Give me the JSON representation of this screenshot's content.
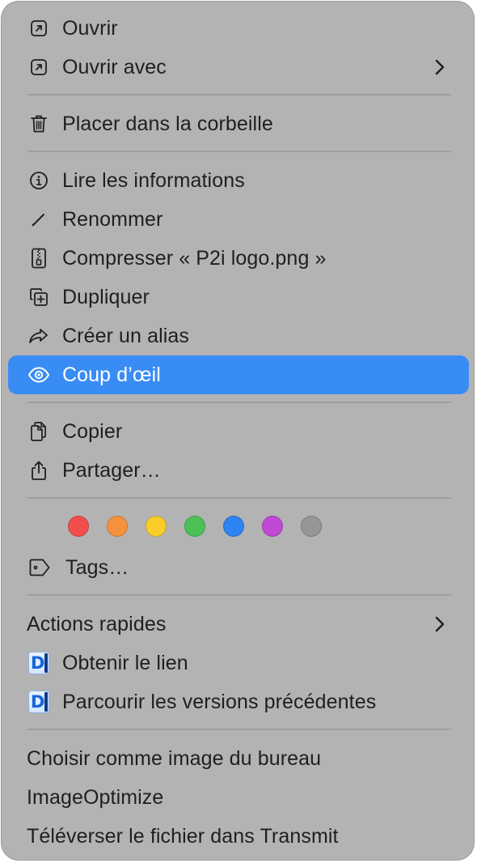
{
  "menu": {
    "open": "Ouvrir",
    "open_with": "Ouvrir avec",
    "trash": "Placer dans la corbeille",
    "get_info": "Lire les informations",
    "rename": "Renommer",
    "compress": "Compresser « P2i logo.png »",
    "duplicate": "Dupliquer",
    "make_alias": "Créer un alias",
    "quick_look": "Coup d’œil",
    "copy": "Copier",
    "share": "Partager…",
    "tags": "Tags…",
    "quick_actions": "Actions rapides",
    "get_link": "Obtenir le lien",
    "browse_versions": "Parcourir les versions précédentes",
    "set_desktop": "Choisir comme image du bureau",
    "image_optimize": "ImageOptimize",
    "upload_transmit": "Téléverser le fichier dans Transmit"
  },
  "tag_colors": [
    {
      "name": "red",
      "color": "#f14e4c"
    },
    {
      "name": "orange",
      "color": "#f5913c"
    },
    {
      "name": "yellow",
      "color": "#f8cd2a"
    },
    {
      "name": "green",
      "color": "#4cc156"
    },
    {
      "name": "blue",
      "color": "#2f84f3"
    },
    {
      "name": "purple",
      "color": "#c04ad6"
    },
    {
      "name": "gray",
      "color": "#969699"
    }
  ],
  "colors": {
    "menu_background": "#b3b3b3",
    "highlight": "#3a8cf5",
    "separator": "#9e9e9e",
    "text": "#1f1f1f"
  },
  "icons": {
    "open": "open-arrow-icon",
    "open_with": "open-arrow-icon",
    "trash": "trash-icon",
    "get_info": "info-icon",
    "rename": "pencil-icon",
    "compress": "zip-archive-icon",
    "duplicate": "duplicate-icon",
    "make_alias": "alias-arrow-icon",
    "quick_look": "eye-icon",
    "copy": "copy-document-icon",
    "share": "share-icon",
    "tags": "tag-icon",
    "get_link": "dropshare-app-icon",
    "browse_versions": "dropshare-app-icon",
    "submenu": "chevron-right-icon"
  }
}
